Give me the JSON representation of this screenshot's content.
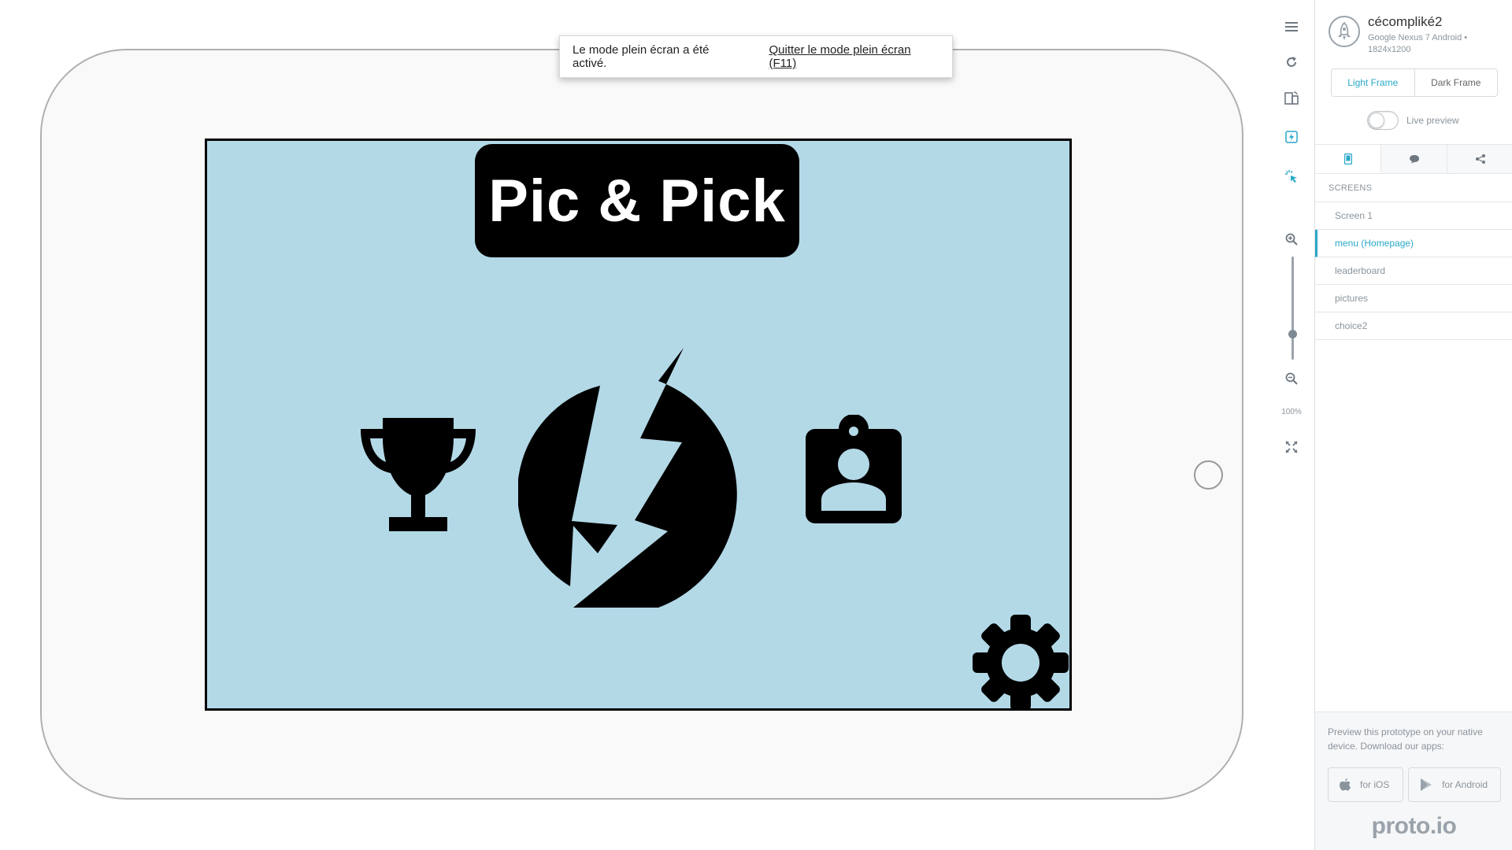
{
  "fullscreen_notice": {
    "message": "Le mode plein écran a été activé.",
    "exit_link": "Quitter le mode plein écran (F11)"
  },
  "prototype": {
    "app_title": "Pic & Pick",
    "screen_bg": "#b3d9e7",
    "icons": [
      "trophy-icon",
      "flash-logo-icon",
      "contact-badge-icon",
      "settings-gear-icon"
    ]
  },
  "toolbar": {
    "items": [
      "menu-icon",
      "refresh-icon",
      "rotate-device-icon",
      "interactions-icon",
      "hotspot-icon",
      "zoom-in-icon",
      "zoom-out-icon",
      "fullscreen-icon"
    ],
    "zoom_label": "100%",
    "zoom_level": 1.0
  },
  "sidebar": {
    "project_name": "cécompliké2",
    "device": "Google Nexus 7 Android • 1824x1200",
    "frame_options": [
      "Light Frame",
      "Dark Frame"
    ],
    "selected_frame": "Light Frame",
    "live_preview_label": "Live preview",
    "live_preview_on": false,
    "tabs": [
      "device-tab",
      "comments-tab",
      "share-tab"
    ],
    "screens_title": "SCREENS",
    "screens": [
      {
        "label": "Screen 1"
      },
      {
        "label": "menu (Homepage)",
        "active": true
      },
      {
        "label": "leaderboard"
      },
      {
        "label": "pictures"
      },
      {
        "label": "choice2"
      }
    ],
    "preview_text": "Preview this prototype on your native device. Download our apps:",
    "ios_label": "for iOS",
    "android_label": "for Android",
    "brand": "proto.io"
  },
  "colors": {
    "accent": "#2aa8c8",
    "muted": "#8a949c"
  }
}
